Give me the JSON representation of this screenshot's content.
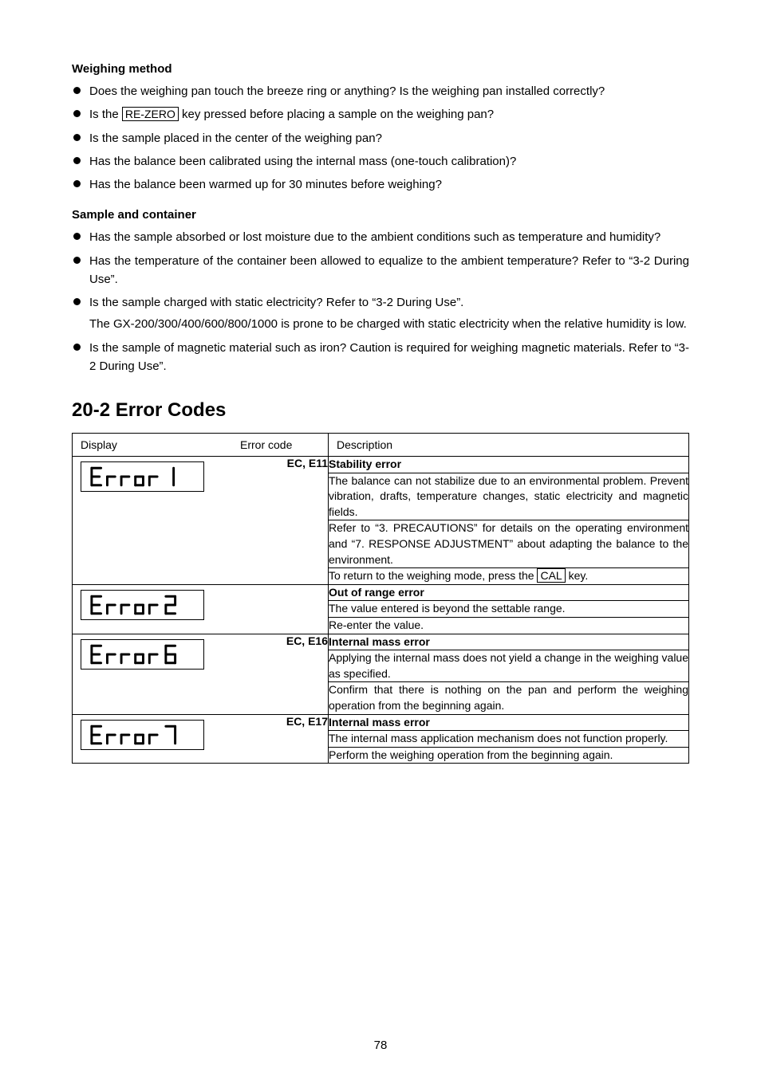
{
  "weighing": {
    "heading": "Weighing method",
    "items": [
      "Does the weighing pan touch the breeze ring or anything? Is the weighing pan installed correctly?",
      " key pressed before placing a sample on the weighing pan?",
      "Is the sample placed in the center of the weighing pan?",
      "Has the balance been calibrated using the internal mass (one-touch calibration)?",
      "Has the balance been warmed up for 30 minutes before weighing?"
    ],
    "item1_prefix": "Is the ",
    "rezero_label": "RE-ZERO"
  },
  "sample": {
    "heading": "Sample and container",
    "items": [
      "Has the sample absorbed or lost moisture due to the ambient conditions such as temperature and humidity?",
      "Has the temperature of the container been allowed to equalize to the ambient temperature? Refer to “3-2 During Use”.",
      "Is the sample charged with static electricity? Refer to “3-2 During Use”.",
      "Is the sample of magnetic material such as iron? Caution is required for weighing magnetic materials. Refer to “3-2 During Use”."
    ],
    "sub_static": "The GX-200/300/400/600/800/1000 is prone to be charged with static electricity when the relative humidity is low."
  },
  "title": "20-2  Error Codes",
  "table": {
    "headers": {
      "display": "Display",
      "code": "Error code",
      "desc": "Description"
    },
    "rows": [
      {
        "code": "EC, E11",
        "display_label": "error-1-display",
        "title": "Stability error",
        "d1": "The balance can not stabilize due to an environmental problem. Prevent vibration, drafts, temperature changes, static electricity and magnetic fields.",
        "d2_pre": "Refer to “3. PRECAUTIONS” for details on the operating environment and “7. RESPONSE ADJUSTMENT” about adapting the balance to the environment.",
        "d3_pre": "To return to the weighing mode, press the ",
        "d3_key": "CAL",
        "d3_post": " key."
      },
      {
        "code": "",
        "display_label": "error-2-display",
        "title": "Out of range error",
        "d1": "The value entered is beyond the settable range.",
        "d2": "Re-enter the value."
      },
      {
        "code": "EC, E16",
        "display_label": "error-6-display",
        "title": "Internal mass error",
        "d1": "Applying the internal mass does not yield a change in the weighing value as specified.",
        "d2": "Confirm that there is nothing on the pan and perform the weighing operation from the beginning again."
      },
      {
        "code": "EC, E17",
        "display_label": "error-7-display",
        "title": "Internal mass error",
        "d1": "The internal mass application mechanism does not function properly.",
        "d2": "Perform the weighing operation from the beginning again."
      }
    ]
  },
  "page_number": "78"
}
